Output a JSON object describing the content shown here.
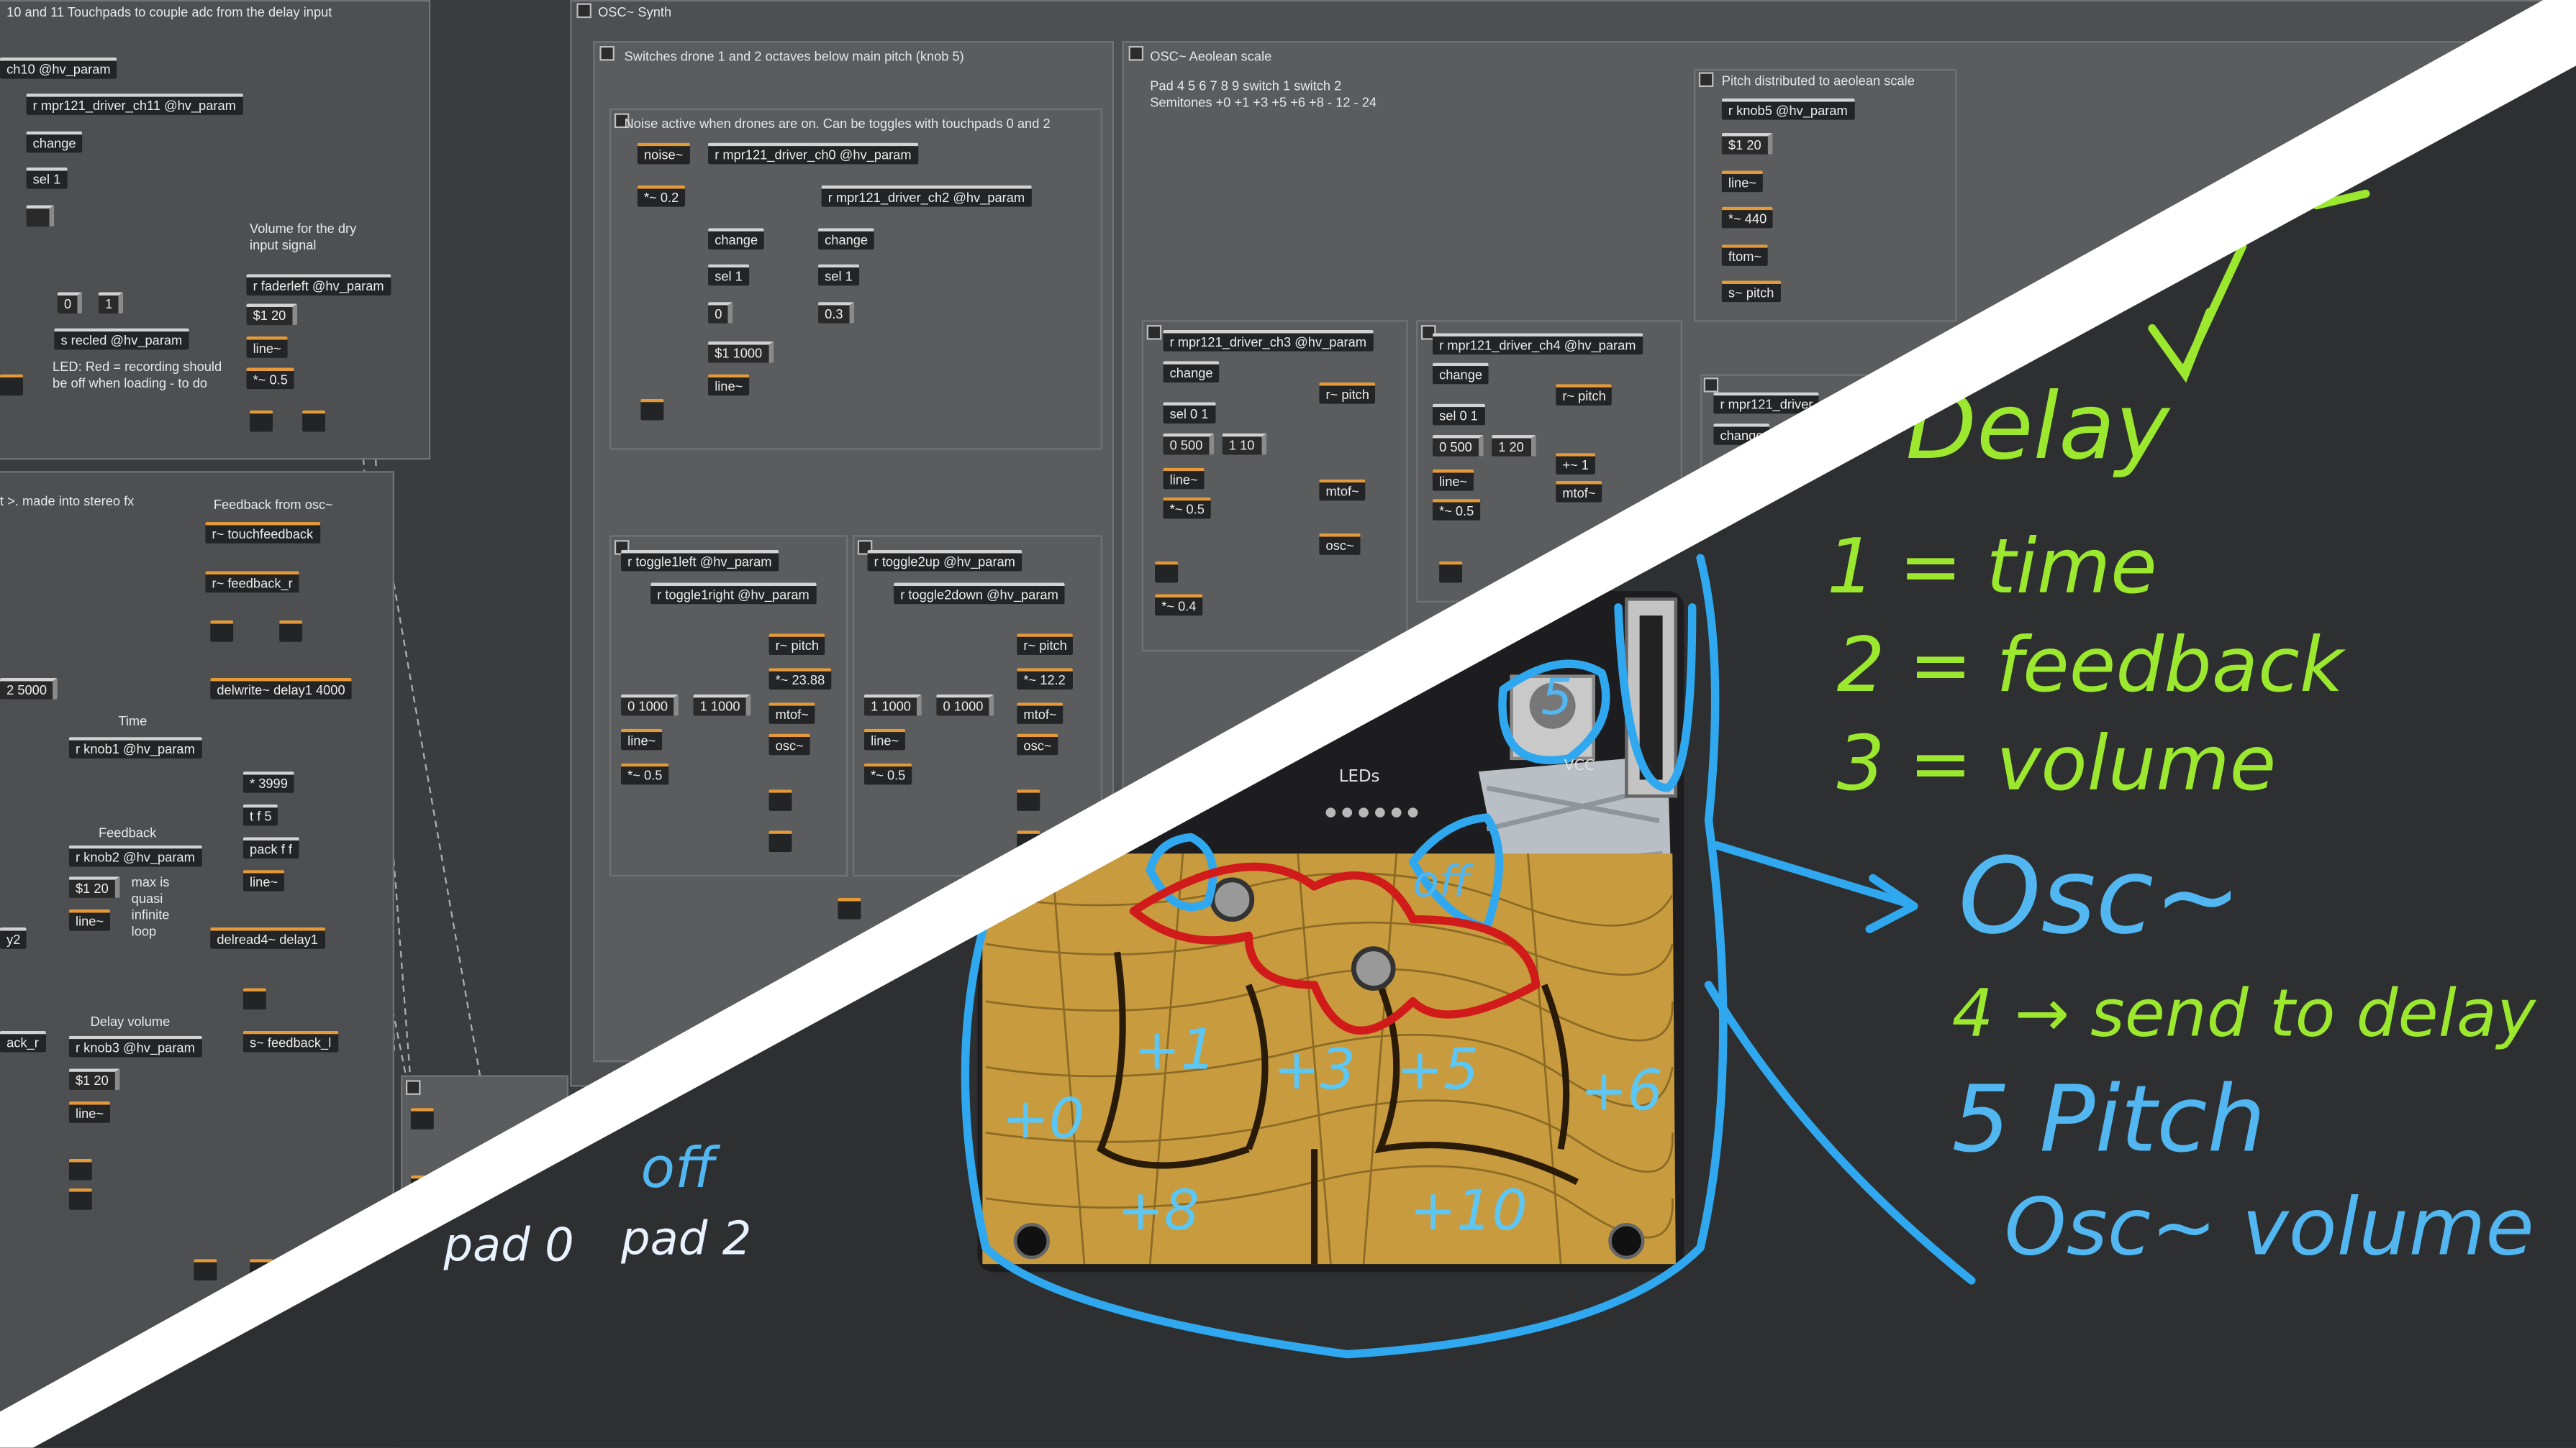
{
  "patch": {
    "panels": {
      "touchpads_title": "10 and 11 Touchpads to couple adc from the delay input",
      "osc_synth_title": "OSC~ Synth",
      "drones_title": "Switches drone 1 and 2 octaves below main pitch (knob 5)",
      "noise_title": "Noise active when drones are on. Can be toggles with touchpads 0 and 2",
      "aeolean_title": "OSC~ Aeolean scale",
      "aeolean_note": "Pad 4 5 6 7 8 9 switch 1 switch 2 Semitones +0 +1 +3 +5 +6 +8 - 12 - 24",
      "pitch_dist_title": "Pitch distributed to aeolean scale"
    },
    "comments": {
      "volume_dry": "Volume for the dry input signal",
      "led_note": "LED: Red = recording should be off when loading - to do",
      "stereo_fx": "t >. made into stereo fx",
      "feedback_from_osc": "Feedback from osc~",
      "time": "Time",
      "feedback": "Feedback",
      "max_quasi": "max is quasi infinite loop",
      "delay_volume": "Delay volume"
    },
    "objects": {
      "ch10": "ch10 @hv_param",
      "ch11": "r mpr121_driver_ch11 @hv_param",
      "change_a": "change",
      "sel1_a": "sel 1",
      "zero_a": "0",
      "one_a": "1",
      "recled": "s recled @hv_param",
      "faderleft": "r faderleft @hv_param",
      "s120_a": "$1 20",
      "line_a": "line~",
      "mul05_a": "*~ 0.5",
      "touchfeedback": "r~ touchfeedback",
      "feedback_r": "r~ feedback_r",
      "delwrite": "delwrite~ delay1 4000",
      "two5000": "2 5000",
      "knob1": "r knob1 @hv_param",
      "n3999": "* 3999",
      "tf5": "t f 5",
      "packff": "pack f f",
      "line_b": "line~",
      "delread": "delread4~ delay1",
      "feedback_l": "s~ feedback_l",
      "knob2": "r knob2 @hv_param",
      "s120_b": "$1 20",
      "line_c": "line~",
      "y2": "y2",
      "ack_r": "ack_r",
      "knob3": "r knob3 @hv_param",
      "s120_c": "$1 20",
      "line_d": "line~",
      "noise": "noise~",
      "mul02": "*~ 0.2",
      "ch0": "r mpr121_driver_ch0 @hv_param",
      "ch2": "r mpr121_driver_ch2 @hv_param",
      "change_b": "change",
      "change_c": "change",
      "sel1_b": "sel 1",
      "sel1_c": "sel 1",
      "zero_b": "0",
      "zero3": "0.3",
      "s1000": "$1 1000",
      "line_e": "line~",
      "toggle1left": "r toggle1left @hv_param",
      "toggle1right": "r toggle1right @hv_param",
      "toggle2up": "r toggle2up @hv_param",
      "toggle2down": "r toggle2down @hv_param",
      "pitch_a": "r~ pitch",
      "m2388": "*~ 23.88",
      "mtof_a": "mtof~",
      "osc_a": "osc~",
      "pitch_b": "r~ pitch",
      "m122": "*~ 12.2",
      "mtof_b": "mtof~",
      "osc_b": "osc~",
      "z1000_a": "0 1000",
      "o1000_a": "1 1000",
      "o1000_b": "1 1000",
      "z1000_b": "0 1000",
      "line_f": "line~",
      "line_g": "line~",
      "mul05_b": "*~ 0.5",
      "mul05_c": "*~ 0.5",
      "ch3": "r mpr121_driver_ch3 @hv_param",
      "ch4": "r mpr121_driver_ch4 @hv_param",
      "change_d": "change",
      "change_e": "change",
      "sel01_a": "sel 0 1",
      "sel01_b": "sel 0 1",
      "z500_a": "0 500",
      "o10": "1 10",
      "z500_b": "0 500",
      "o120": "1 20",
      "line_h": "line~",
      "line_i": "line~",
      "mul05_d": "*~ 0.5",
      "mul05_e": "*~ 0.5",
      "mul04": "*~ 0.4",
      "pitch_c": "r~ pitch",
      "pitch_d": "r~ pitch",
      "mtof_c": "mtof~",
      "mtof_d": "mtof~",
      "osc_c": "osc~",
      "plus1": "+~ 1",
      "knob5": "r knob5 @hv_param",
      "s120_d": "$1 20",
      "line_j": "line~",
      "m440": "*~ 440",
      "ftom": "ftom~",
      "spitch": "s~ pitch",
      "ch5": "r mpr121_driver",
      "change_f": "change"
    }
  },
  "notes": {
    "delay": "Delay",
    "time": "1 = time",
    "feedback": "2 = feedback",
    "volume": "3 = volume",
    "osc": "Osc~",
    "send_delay": "4 → send to delay",
    "pitch": "5 Pitch",
    "osc_volume": "Osc~ volume",
    "off": "off",
    "pad0": "pad 0",
    "pad2": "pad 2",
    "knob_number": "5"
  },
  "pads": [
    "+0",
    "+1",
    "+3",
    "+5",
    "+6",
    "+8",
    "+10"
  ],
  "board": {
    "leds_label": "LEDs",
    "vcc": "VCC"
  },
  "colors": {
    "green_ink": "#9be82e",
    "blue_ink": "#52b6f0",
    "red_ink": "#d11a1a",
    "signal_inlet": "#e59a3a"
  }
}
